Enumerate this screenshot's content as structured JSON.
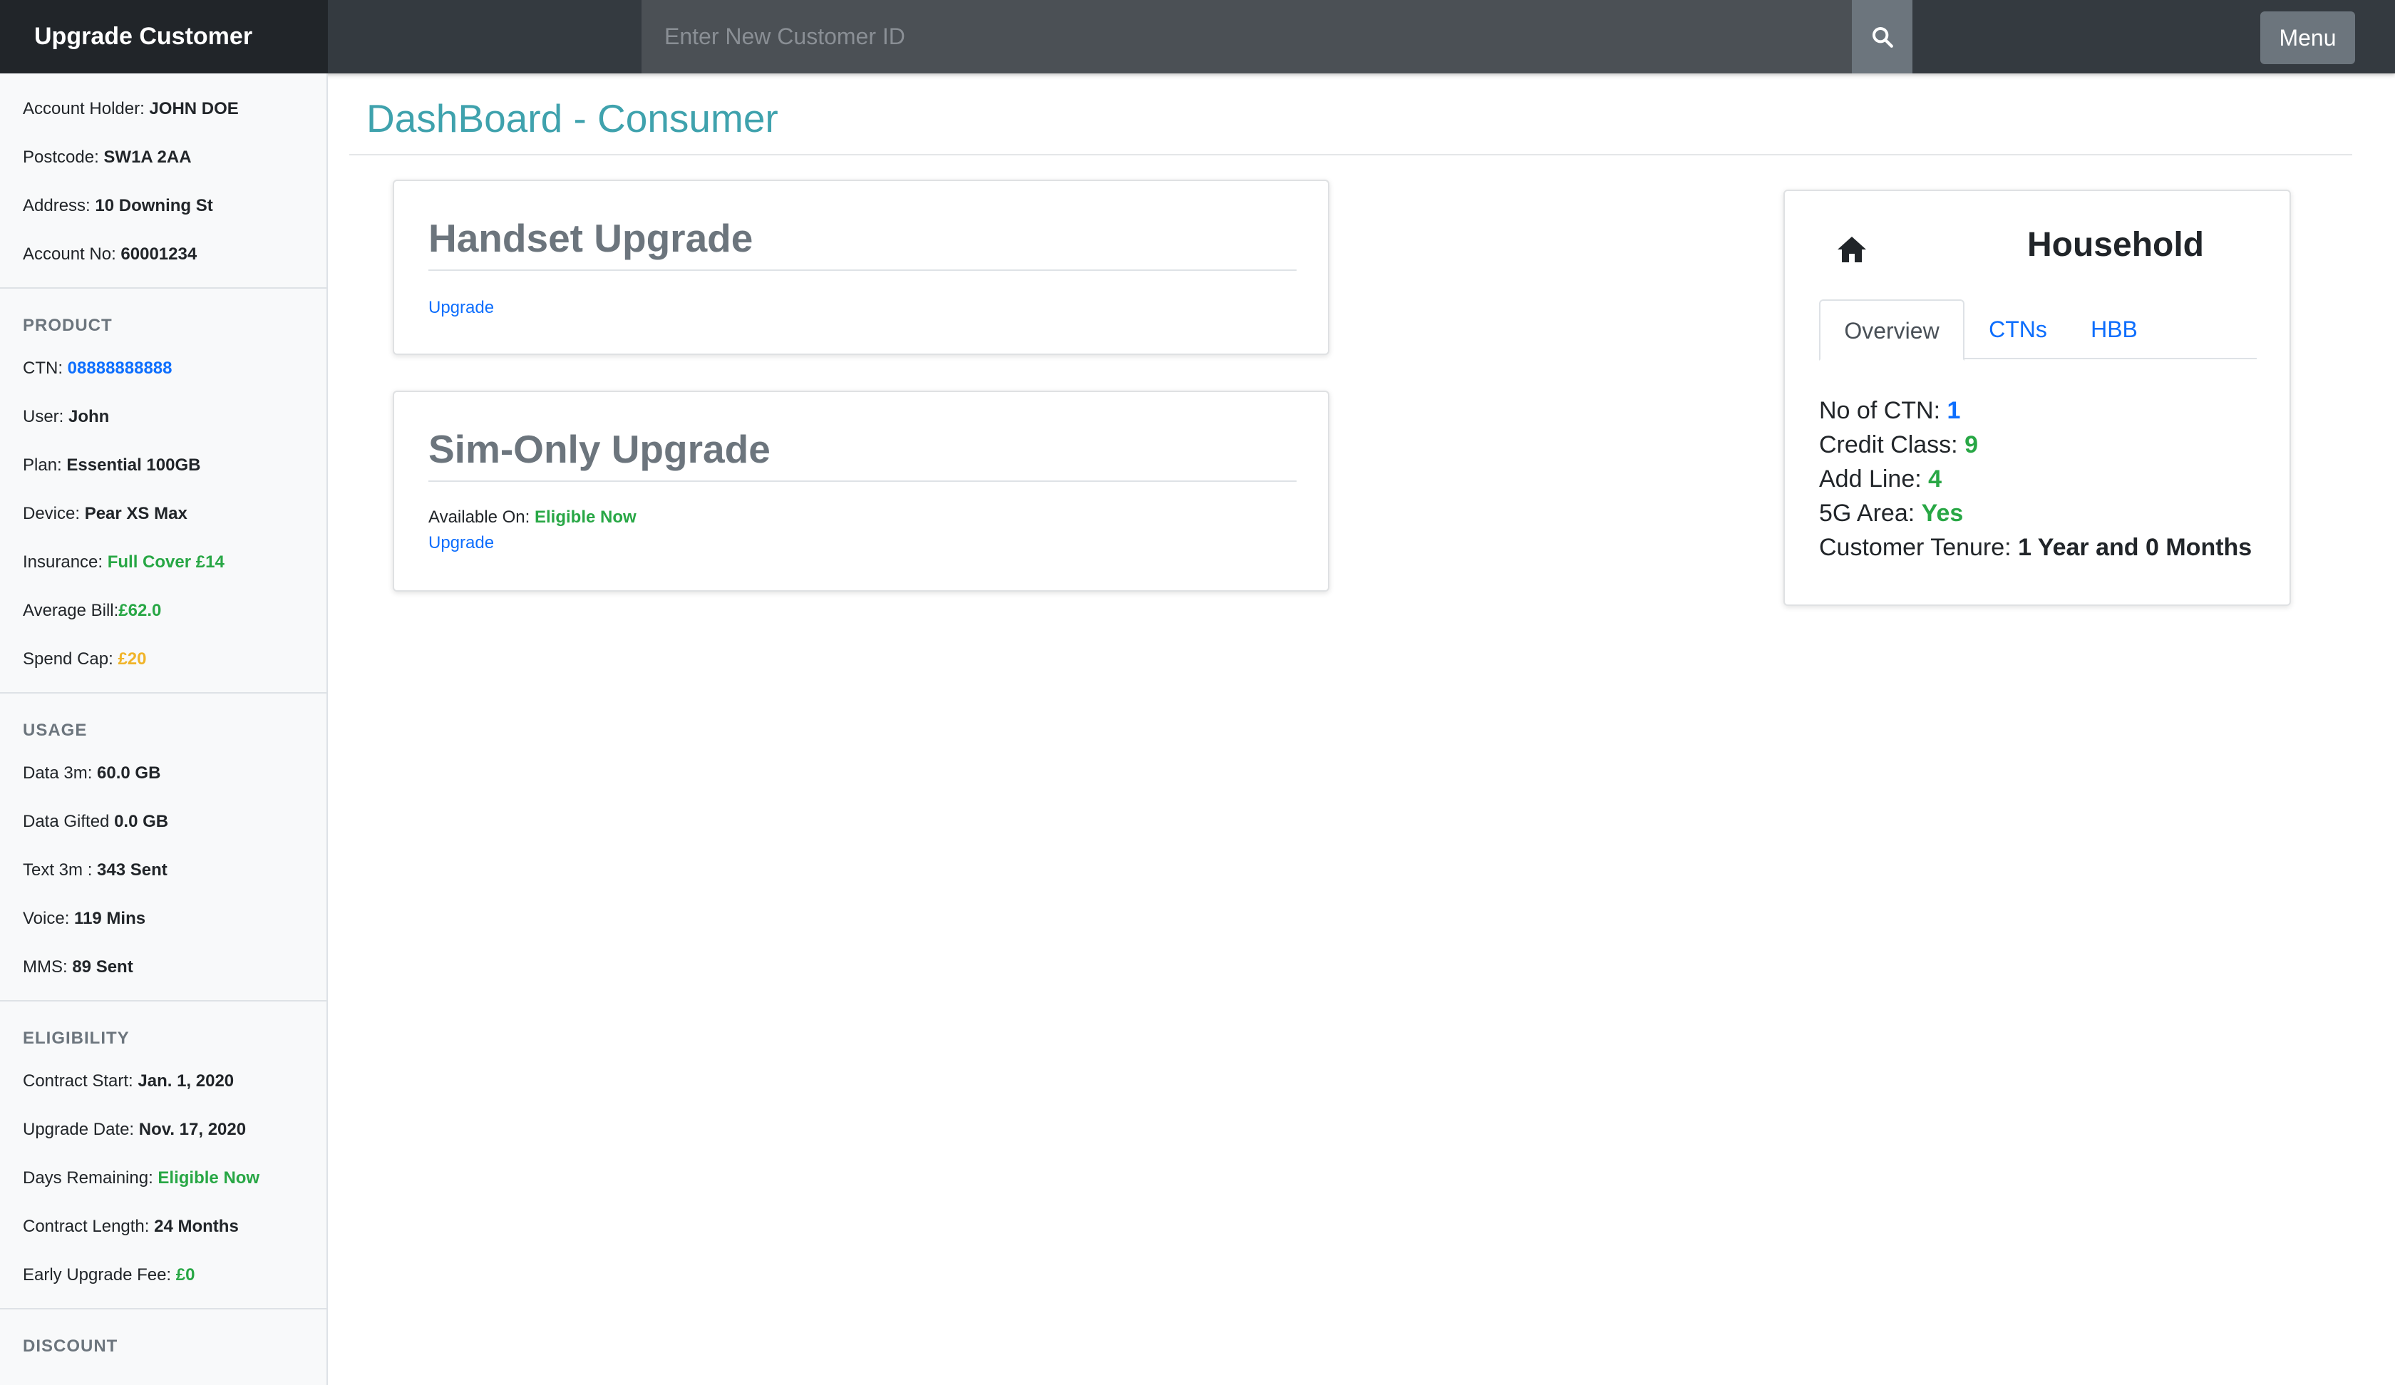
{
  "navbar": {
    "brand": "Upgrade Customer",
    "search_placeholder": "Enter New Customer ID",
    "menu_label": "Menu"
  },
  "sidebar": {
    "account": [
      {
        "label": "Account Holder: ",
        "value": "JOHN DOE"
      },
      {
        "label": "Postcode: ",
        "value": "SW1A 2AA"
      },
      {
        "label": "Address: ",
        "value": "10 Downing St"
      },
      {
        "label": "Account No: ",
        "value": "60001234"
      }
    ],
    "product": {
      "heading": "PRODUCT",
      "ctn_label": "CTN: ",
      "ctn_value": "08888888888",
      "user_label": "User: ",
      "user_value": "John",
      "plan_label": "Plan: ",
      "plan_value": "Essential 100GB",
      "device_label": "Device: ",
      "device_value": "Pear XS Max",
      "insurance_label": "Insurance: ",
      "insurance_value": "Full Cover £14",
      "bill_label": "Average Bill:",
      "bill_value": "£62.0",
      "cap_label": "Spend Cap: ",
      "cap_value": "£20"
    },
    "usage": {
      "heading": "USAGE",
      "rows": [
        {
          "label": "Data 3m: ",
          "value": "60.0 GB"
        },
        {
          "label": "Data Gifted ",
          "value": "0.0 GB"
        },
        {
          "label": "Text 3m : ",
          "value": "343 Sent"
        },
        {
          "label": "Voice: ",
          "value": "119 Mins"
        },
        {
          "label": "MMS: ",
          "value": "89 Sent"
        }
      ]
    },
    "eligibility": {
      "heading": "ELIGIBILITY",
      "start_label": "Contract Start: ",
      "start_value": "Jan. 1, 2020",
      "upgrade_label": "Upgrade Date: ",
      "upgrade_value": "Nov. 17, 2020",
      "days_label": "Days Remaining: ",
      "days_value": "Eligible Now",
      "length_label": "Contract Length: ",
      "length_value": "24 Months",
      "fee_label": "Early Upgrade Fee: ",
      "fee_value": "£0"
    },
    "discount": {
      "heading": "DISCOUNT"
    }
  },
  "main": {
    "title": "DashBoard - Consumer",
    "handset": {
      "title": "Handset Upgrade",
      "link": "Upgrade"
    },
    "simonly": {
      "title": "Sim-Only Upgrade",
      "available_label": "Available On: ",
      "available_value": "Eligible Now",
      "link": "Upgrade"
    }
  },
  "household": {
    "icon": "home-icon",
    "title": "Household",
    "tabs": [
      "Overview",
      "CTNs",
      "HBB"
    ],
    "rows": {
      "ctn_label": "No of CTN: ",
      "ctn_value": "1",
      "credit_label": "Credit Class: ",
      "credit_value": "9",
      "addline_label": "Add Line: ",
      "addline_value": "4",
      "fiveg_label": "5G Area: ",
      "fiveg_value": "Yes",
      "tenure_label": "Customer Tenure: ",
      "tenure_value": "1 Year and 0 Months"
    }
  },
  "colors": {
    "navbar": "#343a40",
    "brand_bg": "#212529",
    "title_teal": "#3fa2ad",
    "link_blue": "#0d6efd",
    "status_green": "#28a745",
    "amber": "#f0b429"
  }
}
